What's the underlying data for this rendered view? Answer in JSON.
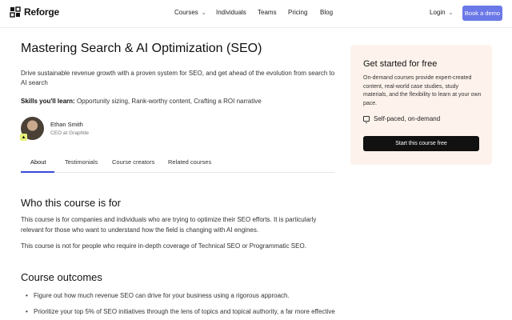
{
  "header": {
    "logo_text": "Reforge",
    "nav": [
      {
        "label": "Courses",
        "has_dropdown": true
      },
      {
        "label": "Individuals",
        "has_dropdown": false
      },
      {
        "label": "Teams",
        "has_dropdown": false
      },
      {
        "label": "Pricing",
        "has_dropdown": false
      },
      {
        "label": "Blog",
        "has_dropdown": false
      }
    ],
    "login_label": "Login",
    "demo_label": "Book a demo",
    "accent_color": "#6b78e8"
  },
  "course": {
    "title": "Mastering Search & AI Optimization (SEO)",
    "description": "Drive sustainable revenue growth with a proven system for SEO, and get ahead of the evolution from search to AI search",
    "skills_label": "Skills you'll learn:",
    "skills_value": "Opportunity sizing, Rank-worthy content, Crafting a ROI narrative",
    "author": {
      "name": "Ethan Smith",
      "role": "CEO at Graphite"
    }
  },
  "tabs": [
    {
      "label": "About",
      "active": true
    },
    {
      "label": "Testimonials",
      "active": false
    },
    {
      "label": "Course creators",
      "active": false
    },
    {
      "label": "Related courses",
      "active": false
    }
  ],
  "sections": {
    "who_title": "Who this course is for",
    "who_para1": "This course is for companies and individuals who are trying to optimize their SEO efforts. It is particularly relevant for those who want to understand how the field is changing with AI engines.",
    "who_para2": "This course is not for people who require in-depth coverage of Technical SEO or Programmatic SEO.",
    "outcomes_title": "Course outcomes",
    "outcomes": [
      "Figure out how much revenue SEO can drive for your business using a rigorous approach.",
      "Prioritize your top 5% of SEO initiatives through the lens of topics and topical authority, a far more effective"
    ]
  },
  "card": {
    "title": "Get started for free",
    "text": "On-demand courses provide expert-created content, real-world case studies, study materials, and the flexibility to learn at your own pace.",
    "feature": "Self-paced, on-demand",
    "button_label": "Start this course free",
    "background": "#fdf3ec"
  }
}
